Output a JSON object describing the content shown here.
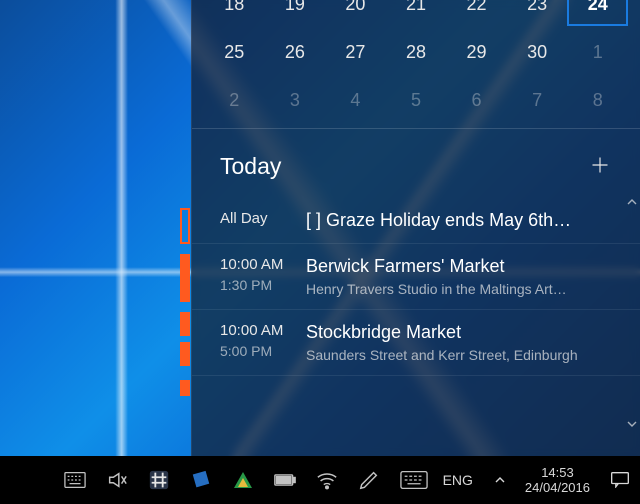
{
  "calendar": {
    "rows": [
      {
        "cells": [
          {
            "n": "18",
            "kind": "cur"
          },
          {
            "n": "19",
            "kind": "cur"
          },
          {
            "n": "20",
            "kind": "cur"
          },
          {
            "n": "21",
            "kind": "cur"
          },
          {
            "n": "22",
            "kind": "cur"
          },
          {
            "n": "23",
            "kind": "cur"
          },
          {
            "n": "24",
            "kind": "today"
          }
        ]
      },
      {
        "cells": [
          {
            "n": "25",
            "kind": "cur"
          },
          {
            "n": "26",
            "kind": "cur"
          },
          {
            "n": "27",
            "kind": "cur"
          },
          {
            "n": "28",
            "kind": "cur"
          },
          {
            "n": "29",
            "kind": "cur"
          },
          {
            "n": "30",
            "kind": "cur"
          },
          {
            "n": "1",
            "kind": "other"
          }
        ]
      },
      {
        "cells": [
          {
            "n": "2",
            "kind": "other"
          },
          {
            "n": "3",
            "kind": "other"
          },
          {
            "n": "4",
            "kind": "other"
          },
          {
            "n": "5",
            "kind": "other"
          },
          {
            "n": "6",
            "kind": "other"
          },
          {
            "n": "7",
            "kind": "other"
          },
          {
            "n": "8",
            "kind": "other"
          }
        ]
      }
    ]
  },
  "agenda": {
    "heading": "Today",
    "events": [
      {
        "bar": "outline",
        "time1": "All Day",
        "time2": "",
        "title": "[  ] Graze Holiday ends May 6th…",
        "loc": ""
      },
      {
        "bar": "solid",
        "time1": "10:00 AM",
        "time2": "1:30 PM",
        "title": "Berwick Farmers' Market",
        "loc": "Henry Travers Studio in the Maltings Art…"
      },
      {
        "bar": "solid",
        "time1": "10:00 AM",
        "time2": "5:00 PM",
        "title": "Stockbridge Market",
        "loc": "Saunders Street and Kerr Street, Edinburgh"
      }
    ]
  },
  "taskbar": {
    "lang": "ENG",
    "time": "14:53",
    "date": "24/04/2016"
  },
  "colors": {
    "accent": "#1a7be0",
    "eventBar": "#ff5a1f"
  }
}
